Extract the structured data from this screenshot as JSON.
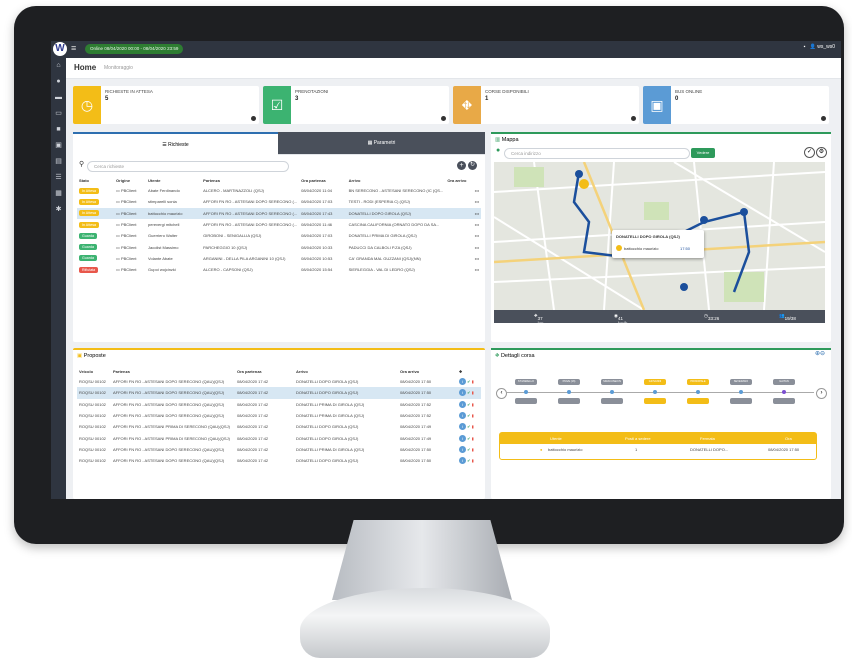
{
  "topbar": {
    "logo": "W",
    "online": "Online 08/04/2020 00:00 - 08/04/2020 23:59",
    "user": "ws_ws0"
  },
  "page": {
    "title": "Home",
    "subtitle": "Monitoraggio"
  },
  "cards": [
    {
      "label": "RICHIESTE IN ATTESA",
      "value": "5",
      "color": "#f3bd17",
      "icon": "clock-icon"
    },
    {
      "label": "PRENOTAZIONI",
      "value": "3",
      "color": "#3cb371",
      "icon": "check-icon"
    },
    {
      "label": "CORSE DISPONIBILI",
      "value": "1",
      "color": "#e8a947",
      "icon": "road-icon"
    },
    {
      "label": "BUS ONLINE",
      "value": "0",
      "color": "#5b9bd5",
      "icon": "bus-icon"
    }
  ],
  "richieste": {
    "tab_richieste": "Richieste",
    "tab_parametri": "Parametri",
    "search_placeholder": "Cerca richieste",
    "columns": [
      "Stato",
      "Origine",
      "Utente",
      "Partenza",
      "Ora partenza",
      "Arrivo",
      "Ora arrivo"
    ],
    "rows": [
      {
        "stato": "In Attesa",
        "color": "#f3bd17",
        "origine": "PBClient",
        "utente": "Abate Ferdinando",
        "partenza": "ALCERO - MARTINAZZOLI (QSJ)",
        "ora": "08/04/2020 11:04",
        "arrivo": "BN SERECONO - ASTESANI SERECONO (IC (QS...",
        "ora_arrivo": ""
      },
      {
        "stato": "In Attesa",
        "color": "#f3bd17",
        "origine": "PBClient",
        "utente": "stimparelli sonia",
        "partenza": "AFFORI FN RO - ASTESANI DOPO SERECONO (...",
        "ora": "08/04/2020 17:03",
        "arrivo": "TESTI - RODI (ESPERIA C) (QSJ)",
        "ora_arrivo": ""
      },
      {
        "stato": "In Attesa",
        "color": "#f3bd17",
        "origine": "PBClient",
        "utente": "battocchio maurizio",
        "partenza": "AFFORI FN RO - ASTESANI DOPO SERECONO (...",
        "ora": "08/04/2020 17:43",
        "arrivo": "DONATELLI DOPO GIROLA (QSJ)",
        "ora_arrivo": ""
      },
      {
        "stato": "In Attesa",
        "color": "#f3bd17",
        "origine": "PBClient",
        "utente": "perevergi mitchell",
        "partenza": "AFFORI FN RO - ASTESANI DOPO SERECONO (...",
        "ora": "08/04/2020 11:46",
        "arrivo": "CASCINA CALIFORNIA (ORNATO DOPO DA SA...",
        "ora_arrivo": ""
      },
      {
        "stato": "Guarda",
        "color": "#3cb371",
        "origine": "PBClient",
        "utente": "Guerriero Walter",
        "partenza": "GIROBONI - SENIGALLIA (QSJ)",
        "ora": "08/04/2020 17:03",
        "arrivo": "DONATELLI PRIMA DI GIROLA (QSJ)",
        "ora_arrivo": ""
      },
      {
        "stato": "Guarda",
        "color": "#3cb371",
        "origine": "PBClient",
        "utente": "Jacolist Massimo",
        "partenza": "PARCHEGGIO 10 (QSJ)",
        "ora": "08/04/2020 10:33",
        "arrivo": "PADUCCI DA CALBOLI P.ZA (QSJ)",
        "ora_arrivo": ""
      },
      {
        "stato": "Guarda",
        "color": "#3cb371",
        "origine": "PBClient",
        "utente": "Volante Abate",
        "partenza": "ARGANINI - DELLA PILA ARGANINI 10 (QSJ)",
        "ora": "08/04/2020 10:53",
        "arrivo": "CA' GRANDA MAL GUZZANI (QSJ)(NN)",
        "ora_arrivo": ""
      },
      {
        "stato": "Rifiutata",
        "color": "#e8574b",
        "origine": "PBClient",
        "utente": "Gupoi wojcinzki",
        "partenza": "ALCERO - CAPSONI (QSJ)",
        "ora": "08/04/2020 15:54",
        "arrivo": "SIERLEGGIA - VAL DI LEDRO (QSJ)",
        "ora_arrivo": ""
      }
    ]
  },
  "proposte": {
    "title": "Proposte",
    "columns": [
      "Veicolo",
      "Partenza",
      "Ora partenza",
      "Arrivo",
      "Ora arrivo"
    ],
    "rows": [
      {
        "veicolo": "ROQSU 00102",
        "partenza": "AFFORI FN RO - ASTESANI DOPO SERECONO (QAU)(QSJ)",
        "ora": "08/04/2020 17:42",
        "arrivo": "DONATELLI DOPO GIROLA (QSJ)",
        "ora_arrivo": "08/04/2020 17:50"
      },
      {
        "veicolo": "ROQSU 00102",
        "partenza": "AFFORI FN RO - ASTESANI DOPO SERECONO (QAU)(QSJ)",
        "ora": "08/04/2020 17:42",
        "arrivo": "DONATELLI DOPO GIROLA (QSJ)",
        "ora_arrivo": "08/04/2020 17:50"
      },
      {
        "veicolo": "ROQSU 00102",
        "partenza": "AFFORI FN RO - ASTESANI DOPO SERECONO (QAU)(QSJ)",
        "ora": "08/04/2020 17:42",
        "arrivo": "DONATELLI PRIMA DI GIROLA (QSJ)",
        "ora_arrivo": "08/04/2020 17:52"
      },
      {
        "veicolo": "ROQSU 00102",
        "partenza": "AFFORI FN RO - ASTESANI DOPO SERECONO (QAU)(QSJ)",
        "ora": "08/04/2020 17:42",
        "arrivo": "DONATELLI PRIMA DI GIROLA (QSJ)",
        "ora_arrivo": "08/04/2020 17:52"
      },
      {
        "veicolo": "ROQSU 00102",
        "partenza": "AFFORI FN RO - ASTESANI PRIMA DI SERECONO (QAU)(QSJ)",
        "ora": "08/04/2020 17:42",
        "arrivo": "DONATELLI DOPO GIROLA (QSJ)",
        "ora_arrivo": "08/04/2020 17:49"
      },
      {
        "veicolo": "ROQSU 00102",
        "partenza": "AFFORI FN RO - ASTESANI PRIMA DI SERECONO (QAU)(QSJ)",
        "ora": "08/04/2020 17:42",
        "arrivo": "DONATELLI DOPO GIROLA (QSJ)",
        "ora_arrivo": "08/04/2020 17:49"
      },
      {
        "veicolo": "ROQSU 00102",
        "partenza": "AFFORI FN RO - ASTESANI DOPO SERECONO (QAU)(QSJ)",
        "ora": "08/04/2020 17:42",
        "arrivo": "DONATELLI PRIMA DI GIROLA (QSJ)",
        "ora_arrivo": "08/04/2020 17:50"
      },
      {
        "veicolo": "ROQSU 00102",
        "partenza": "AFFORI FN RO - ASTESANI DOPO SERECONO (QAU)(QSJ)",
        "ora": "08/04/2020 17:42",
        "arrivo": "DONATELLI DOPO GIROLA (QSJ)",
        "ora_arrivo": "08/04/2020 17:50"
      }
    ]
  },
  "mappa": {
    "title": "Mappa",
    "search_placeholder": "Cerca indirizzo",
    "button": "Vedere",
    "popup_title": "DONATELLI DOPO GIROLA (QSJ)",
    "popup_user": "battocchio maurizio",
    "popup_time": "17:50",
    "stats": {
      "distance": "37 km",
      "speed": "41 km/h",
      "time": "33:26",
      "passengers": "19/38"
    }
  },
  "dettagli": {
    "title": "Dettagli corsa",
    "stops": [
      "ST.MARELLO",
      "PIAVE (16)",
      "SIRACUSE/CN",
      "GIOVANNI",
      "PRINCIPALE",
      "SEVERANO",
      "GAITAN"
    ],
    "table_header": [
      "Utente",
      "Posti a sedere",
      "Fermata",
      "Ora"
    ],
    "row": {
      "utente": "battocchio maurizio",
      "posti": "1",
      "fermata": "DONATELLI DOPO...",
      "ora": "08/04/2020 17:50"
    }
  }
}
